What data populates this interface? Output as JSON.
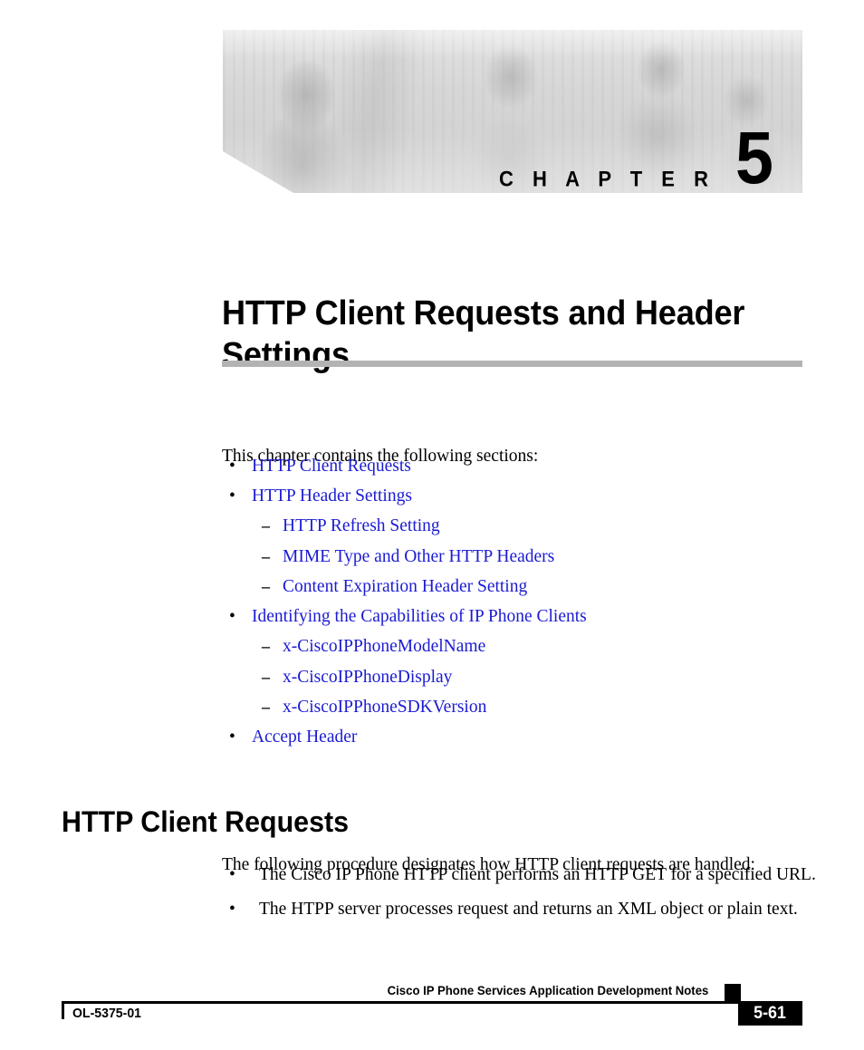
{
  "banner": {
    "chapter_word": "C H A P T E R",
    "chapter_number": "5",
    "photo_alt": "chapter-banner-photo"
  },
  "chapter": {
    "title": "HTTP Client Requests and Header Settings"
  },
  "toc": {
    "intro": "This chapter contains the following sections:",
    "items": [
      {
        "level": 1,
        "marker": "•",
        "label": "HTTP Client Requests"
      },
      {
        "level": 1,
        "marker": "•",
        "label": "HTTP Header Settings"
      },
      {
        "level": 2,
        "marker": "–",
        "label": "HTTP Refresh Setting"
      },
      {
        "level": 2,
        "marker": "–",
        "label": "MIME Type and Other HTTP Headers"
      },
      {
        "level": 2,
        "marker": "–",
        "label": "Content Expiration Header Setting"
      },
      {
        "level": 1,
        "marker": "•",
        "label": "Identifying the Capabilities of IP Phone Clients"
      },
      {
        "level": 2,
        "marker": "–",
        "label": "x-CiscoIPPhoneModelName"
      },
      {
        "level": 2,
        "marker": "–",
        "label": "x-CiscoIPPhoneDisplay"
      },
      {
        "level": 2,
        "marker": "–",
        "label": "x-CiscoIPPhoneSDKVersion"
      },
      {
        "level": 1,
        "marker": "•",
        "label": "Accept Header"
      }
    ]
  },
  "section": {
    "heading": "HTTP Client Requests",
    "intro": "The following procedure designates how HTTP client requests are handled:",
    "bullets": [
      {
        "marker": "•",
        "text": "The Cisco IP Phone HTTP client performs an HTTP GET for a specified URL."
      },
      {
        "marker": "•",
        "text": "The HTPP server processes request and returns an XML object or plain text."
      }
    ]
  },
  "footer": {
    "doc_title": "Cisco IP Phone Services Application Development Notes",
    "doc_id": "OL-5375-01",
    "page_number": "5-61"
  },
  "colors": {
    "link": "#1b1bd2",
    "rule_gray": "#b3b3b3",
    "text": "#000000",
    "footer_box": "#000000"
  }
}
